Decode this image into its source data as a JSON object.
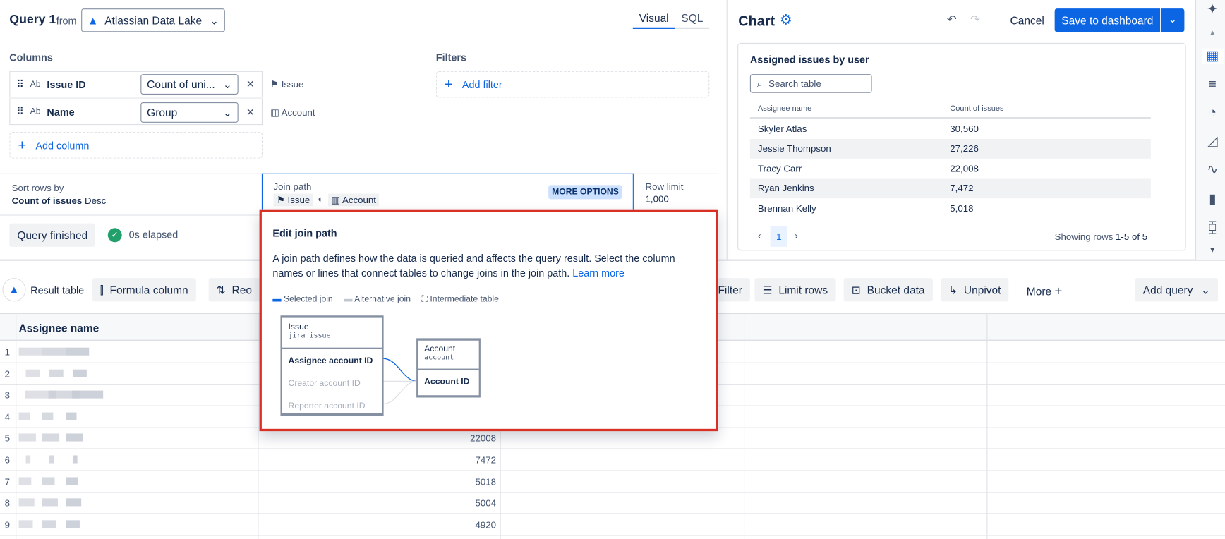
{
  "query": {
    "title": "Query 1",
    "from": "from",
    "source": "Atlassian Data Lake",
    "tabs": [
      "Visual",
      "SQL"
    ],
    "active_tab": "Visual"
  },
  "columns": {
    "label": "Columns",
    "items": [
      {
        "type": "Ab",
        "name": "Issue ID",
        "aggregation": "Count of uni...",
        "table": "Issue"
      },
      {
        "type": "Ab",
        "name": "Name",
        "aggregation": "Group",
        "table": "Account"
      }
    ],
    "add": "Add column"
  },
  "filters": {
    "label": "Filters",
    "add": "Add filter"
  },
  "sort": {
    "label": "Sort rows by",
    "field": "Count of issues",
    "direction": "Desc"
  },
  "join_path": {
    "label": "Join path",
    "from": "Issue",
    "to": "Account",
    "more": "MORE OPTIONS"
  },
  "row_limit": {
    "label": "Row limit",
    "value": "1,000"
  },
  "status": {
    "state": "Query finished",
    "elapsed": "0s elapsed"
  },
  "popup": {
    "title": "Edit join path",
    "description": "A join path defines how the data is queried and affects the query result. Select the column names or lines that connect tables to change joins in the join path.",
    "learn_more": "Learn more",
    "legend": [
      "Selected join",
      "Alternative join",
      "Intermediate table"
    ],
    "left_table": {
      "name": "Issue",
      "id": "jira_issue",
      "fields": [
        "Assignee account ID",
        "Creator account ID",
        "Reporter account ID"
      ]
    },
    "right_table": {
      "name": "Account",
      "id": "account",
      "fields": [
        "Account ID"
      ]
    }
  },
  "chart": {
    "title": "Chart",
    "undo": "undo",
    "cancel": "Cancel",
    "save": "Save to dashboard",
    "card_title": "Assigned issues by user",
    "search_placeholder": "Search table",
    "headers": [
      "Assignee name",
      "Count of issues"
    ],
    "rows": [
      [
        "Skyler Atlas",
        "30,560"
      ],
      [
        "Jessie Thompson",
        "27,226"
      ],
      [
        "Tracy Carr",
        "22,008"
      ],
      [
        "Ryan Jenkins",
        "7,472"
      ],
      [
        "Brennan Kelly",
        "5,018"
      ]
    ],
    "page": "1",
    "showing_prefix": "Showing rows",
    "showing_range": "1-5 of 5"
  },
  "toolbar": {
    "result": "Result table",
    "formula": "Formula column",
    "reorder": "Reo",
    "filter": "Filter",
    "limit": "Limit rows",
    "bucket": "Bucket data",
    "unpivot": "Unpivot",
    "more": "More",
    "add_query": "Add query"
  },
  "result": {
    "header": "Assignee name",
    "rows": [
      {
        "n": "1",
        "v": ""
      },
      {
        "n": "2",
        "v": ""
      },
      {
        "n": "3",
        "v": ""
      },
      {
        "n": "4",
        "v": ""
      },
      {
        "n": "5",
        "v": "22008"
      },
      {
        "n": "6",
        "v": "7472"
      },
      {
        "n": "7",
        "v": "5018"
      },
      {
        "n": "8",
        "v": "5004"
      },
      {
        "n": "9",
        "v": "4920"
      }
    ]
  },
  "colors": {
    "accent": "#0c66e4",
    "highlight": "#d93025",
    "success": "#22a06b"
  }
}
